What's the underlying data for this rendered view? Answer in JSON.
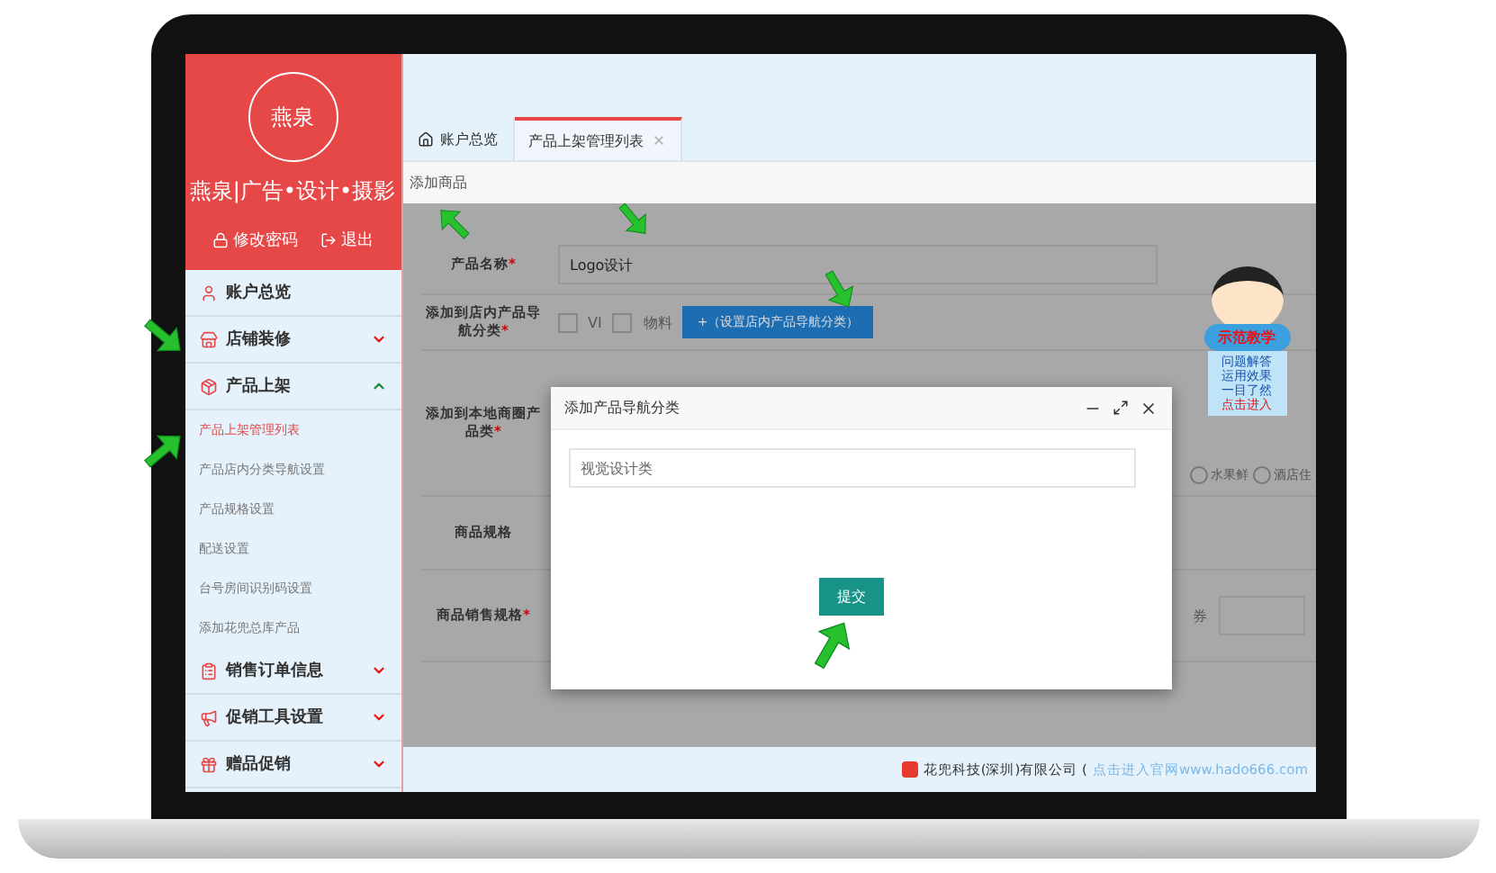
{
  "sidebar": {
    "brand": "燕泉|广告•设计•摄影",
    "logo_text": "燕泉",
    "actions": [
      {
        "label": "修改密码",
        "kind": "lock"
      },
      {
        "label": "退出",
        "kind": "exit"
      }
    ],
    "menu": [
      {
        "label": "账户总览",
        "kind": "user"
      },
      {
        "label": "店铺装修",
        "kind": "shop",
        "expanded": false
      },
      {
        "label": "产品上架",
        "kind": "box",
        "expanded": true,
        "children": [
          {
            "label": "产品上架管理列表",
            "selected": true
          },
          {
            "label": "产品店内分类导航设置",
            "selected": false
          },
          {
            "label": "产品规格设置",
            "selected": false
          },
          {
            "label": "配送设置",
            "selected": false
          },
          {
            "label": "台号房间识别码设置",
            "selected": false
          },
          {
            "label": "添加花兜总库产品",
            "selected": false
          }
        ]
      },
      {
        "label": "销售订单信息",
        "kind": "list",
        "expanded": false
      },
      {
        "label": "促销工具设置",
        "kind": "horn",
        "expanded": false
      },
      {
        "label": "赠品促销",
        "kind": "gift",
        "expanded": false
      }
    ]
  },
  "tabs": [
    {
      "label": "账户总览",
      "selected": false,
      "closable": false
    },
    {
      "label": "产品上架管理列表",
      "selected": true,
      "closable": true
    }
  ],
  "breadcrumb": "添加商品",
  "form": {
    "rows": [
      {
        "label": "产品名称",
        "required_mark": "*",
        "kind": "text",
        "value": "Logo设计"
      },
      {
        "label": "添加到店内产品导航分类",
        "required_mark": "*",
        "kind": "checks",
        "options": [
          {
            "label": "VI",
            "checked": false
          },
          {
            "label": "物料",
            "checked": false
          }
        ],
        "button": "+（设置店内产品导航分类）"
      },
      {
        "label": "添加到本地商圈产品类",
        "required_mark": "*",
        "kind": "radios",
        "options": [
          {
            "label": "水果鲜",
            "selected": false
          },
          {
            "label": "酒店住",
            "selected": false
          }
        ]
      },
      {
        "label": "商品规格",
        "kind": "empty"
      },
      {
        "label": "商品销售规格",
        "required_mark": "*",
        "kind": "partial",
        "value": "券"
      }
    ]
  },
  "dialog": {
    "title": "添加产品导航分类",
    "value": "视觉设计类",
    "submit": "提交"
  },
  "mascot": {
    "badge": "示范教学",
    "lines": [
      "问题解答",
      "运用效果",
      "一目了然"
    ],
    "cta": "点击进入"
  },
  "footer": {
    "company": "花兜科技(深圳)有限公司 (",
    "link": "点击进入官网www.hado666.com"
  }
}
